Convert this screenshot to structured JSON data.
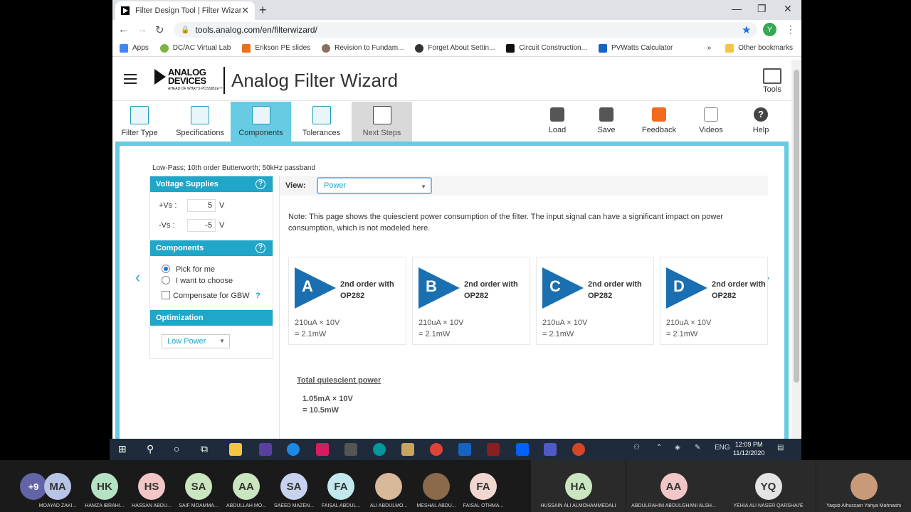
{
  "browser": {
    "tab_title": "Filter Design Tool | Filter Wizard",
    "url": "tools.analog.com/en/filterwizard/",
    "profile_initial": "Y",
    "bookmarks": [
      "Apps",
      "DC/AC Virtual Lab",
      "Erikson PE slides",
      "Revision to Fundam...",
      "Forget About Settin...",
      "Circuit Construction...",
      "PVWatts Calculator"
    ],
    "more_bookmarks": "»",
    "other_bookmarks": "Other bookmarks"
  },
  "site": {
    "logo_line1": "ANALOG",
    "logo_line2": "DEVICES",
    "logo_tagline": "AHEAD OF WHAT'S POSSIBLE™",
    "title": "Analog Filter Wizard",
    "tools_label": "Tools"
  },
  "toolbar": {
    "steps": [
      "Filter Type",
      "Specifications",
      "Components",
      "Tolerances",
      "Next Steps"
    ],
    "active_step": "Components",
    "actions": [
      "Load",
      "Save",
      "Feedback",
      "Videos",
      "Help"
    ]
  },
  "filter_summary": "Low-Pass; 10th order Butterworth; 50kHz passband",
  "sidebar": {
    "voltage_header": "Voltage Supplies",
    "vpos_label": "+Vs :",
    "vpos_value": "5",
    "vneg_label": "-Vs :",
    "vneg_value": "-5",
    "unit": "V",
    "components_header": "Components",
    "pick_for_me": "Pick for me",
    "i_want_to_choose": "I want to choose",
    "compensate_gbw": "Compensate for GBW",
    "help_q": "?",
    "optimization_header": "Optimization",
    "optimization_value": "Low Power"
  },
  "main": {
    "view_label": "View:",
    "view_value": "Power",
    "note": "Note: This page shows the quiescient power consumption of the filter. The input signal can have a significant impact on power consumption, which is not modeled here.",
    "stages": [
      {
        "letter": "A",
        "title": "2nd order with OP282",
        "calc": "210uA × 10V",
        "result": "= 2.1mW"
      },
      {
        "letter": "B",
        "title": "2nd order with OP282",
        "calc": "210uA × 10V",
        "result": "= 2.1mW"
      },
      {
        "letter": "C",
        "title": "2nd order with OP282",
        "calc": "210uA × 10V",
        "result": "= 2.1mW"
      },
      {
        "letter": "D",
        "title": "2nd order with OP282",
        "calc": "210uA × 10V",
        "result": "= 2.1mW"
      }
    ],
    "total_header": "Total quiescient power",
    "total_calc": "1.05mA × 10V",
    "total_result": "= 10.5mW"
  },
  "taskbar": {
    "lang": "ENG",
    "time": "12:09 PM",
    "date": "11/12/2020"
  },
  "participants": {
    "more": "+9",
    "people": [
      {
        "initials": "MA",
        "name": "MOAYAD ZAKI...",
        "color": "#b7c4e6"
      },
      {
        "initials": "HK",
        "name": "HAMZA IBRAHI...",
        "color": "#b6e2c4"
      },
      {
        "initials": "HS",
        "name": "HASSAN ABDU...",
        "color": "#f2c6c6"
      },
      {
        "initials": "SA",
        "name": "SAIF MOAMMA...",
        "color": "#c9e6c0"
      },
      {
        "initials": "AA",
        "name": "ABDULLAH MO...",
        "color": "#c9e6c0"
      },
      {
        "initials": "SA",
        "name": "SAEED MAZEN...",
        "color": "#c7d3ee"
      },
      {
        "initials": "FA",
        "name": "FAISAL ABDUL...",
        "color": "#c2e8ee"
      },
      {
        "initials": "",
        "name": "ALI ABDULMO...",
        "color": "#d7b899"
      },
      {
        "initials": "",
        "name": "MESHAL ABDU...",
        "color": "#8a6a4a"
      },
      {
        "initials": "FA",
        "name": "FAISAL OTHMA...",
        "color": "#f1d7d0"
      },
      {
        "initials": "HA",
        "name": "HUSSAIN ALI ALMOHAMMEDALI",
        "color": "#c9e6c0"
      },
      {
        "initials": "AA",
        "name": "ABDULRAHIM ABDULGHANI ALSH...",
        "color": "#f2c6c6"
      },
      {
        "initials": "YQ",
        "name": "YEHIA ALI NASER QARSHAI'E",
        "color": "#e4e4e4"
      },
      {
        "initials": "",
        "name": "Yaqub Alhussain Yahya Mahnashi",
        "color": "#c99a7a"
      }
    ]
  },
  "colors": {
    "brand_teal": "#1fa6c8",
    "active_tab": "#66cbe3",
    "stage_blue": "#1a6fb0"
  }
}
